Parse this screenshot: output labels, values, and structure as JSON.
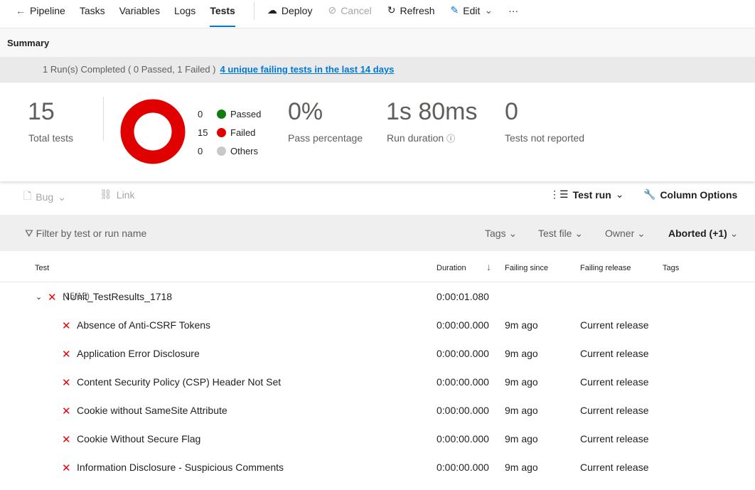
{
  "nav": {
    "tabs": [
      "Pipeline",
      "Tasks",
      "Variables",
      "Logs",
      "Tests"
    ],
    "active": "Tests",
    "actions": {
      "deploy": "Deploy",
      "cancel": "Cancel",
      "refresh": "Refresh",
      "edit": "Edit",
      "more": "···"
    }
  },
  "summary": {
    "title": "Summary",
    "run_text": "1 Run(s) Completed ( 0 Passed, 1 Failed )",
    "run_link": "4 unique failing tests in the last 14 days",
    "total": "15",
    "total_label": "Total tests",
    "legend": [
      {
        "count": "0",
        "label": "Passed",
        "color": "#107c10"
      },
      {
        "count": "15",
        "label": "Failed",
        "color": "#e00000"
      },
      {
        "count": "0",
        "label": "Others",
        "color": "#c8c8c8"
      }
    ],
    "pass_pct": "0%",
    "pass_pct_label": "Pass percentage",
    "duration": "1s 80ms",
    "duration_label": "Run duration",
    "not_reported": "0",
    "not_reported_label": "Tests not reported"
  },
  "toolbar": {
    "bug": "Bug",
    "link": "Link",
    "test_run": "Test run",
    "column_options": "Column Options"
  },
  "filter": {
    "placeholder": "Filter by test or run name",
    "tags": "Tags",
    "test_file": "Test file",
    "owner": "Owner",
    "outcome": "Aborted (+1)"
  },
  "table": {
    "headers": {
      "test": "Test",
      "duration": "Duration",
      "failing_since": "Failing since",
      "failing_release": "Failing release",
      "tags": "Tags"
    },
    "group": {
      "name": "NUnit_TestResults_1718",
      "count": "(15/15)",
      "duration": "0:00:01.080"
    },
    "rows": [
      {
        "name": "Absence of Anti-CSRF Tokens",
        "duration": "0:00:00.000",
        "since": "9m ago",
        "release": "Current release"
      },
      {
        "name": "Application Error Disclosure",
        "duration": "0:00:00.000",
        "since": "9m ago",
        "release": "Current release"
      },
      {
        "name": "Content Security Policy (CSP) Header Not Set",
        "duration": "0:00:00.000",
        "since": "9m ago",
        "release": "Current release"
      },
      {
        "name": "Cookie without SameSite Attribute",
        "duration": "0:00:00.000",
        "since": "9m ago",
        "release": "Current release"
      },
      {
        "name": "Cookie Without Secure Flag",
        "duration": "0:00:00.000",
        "since": "9m ago",
        "release": "Current release"
      },
      {
        "name": "Information Disclosure - Suspicious Comments",
        "duration": "0:00:00.000",
        "since": "9m ago",
        "release": "Current release"
      }
    ]
  }
}
